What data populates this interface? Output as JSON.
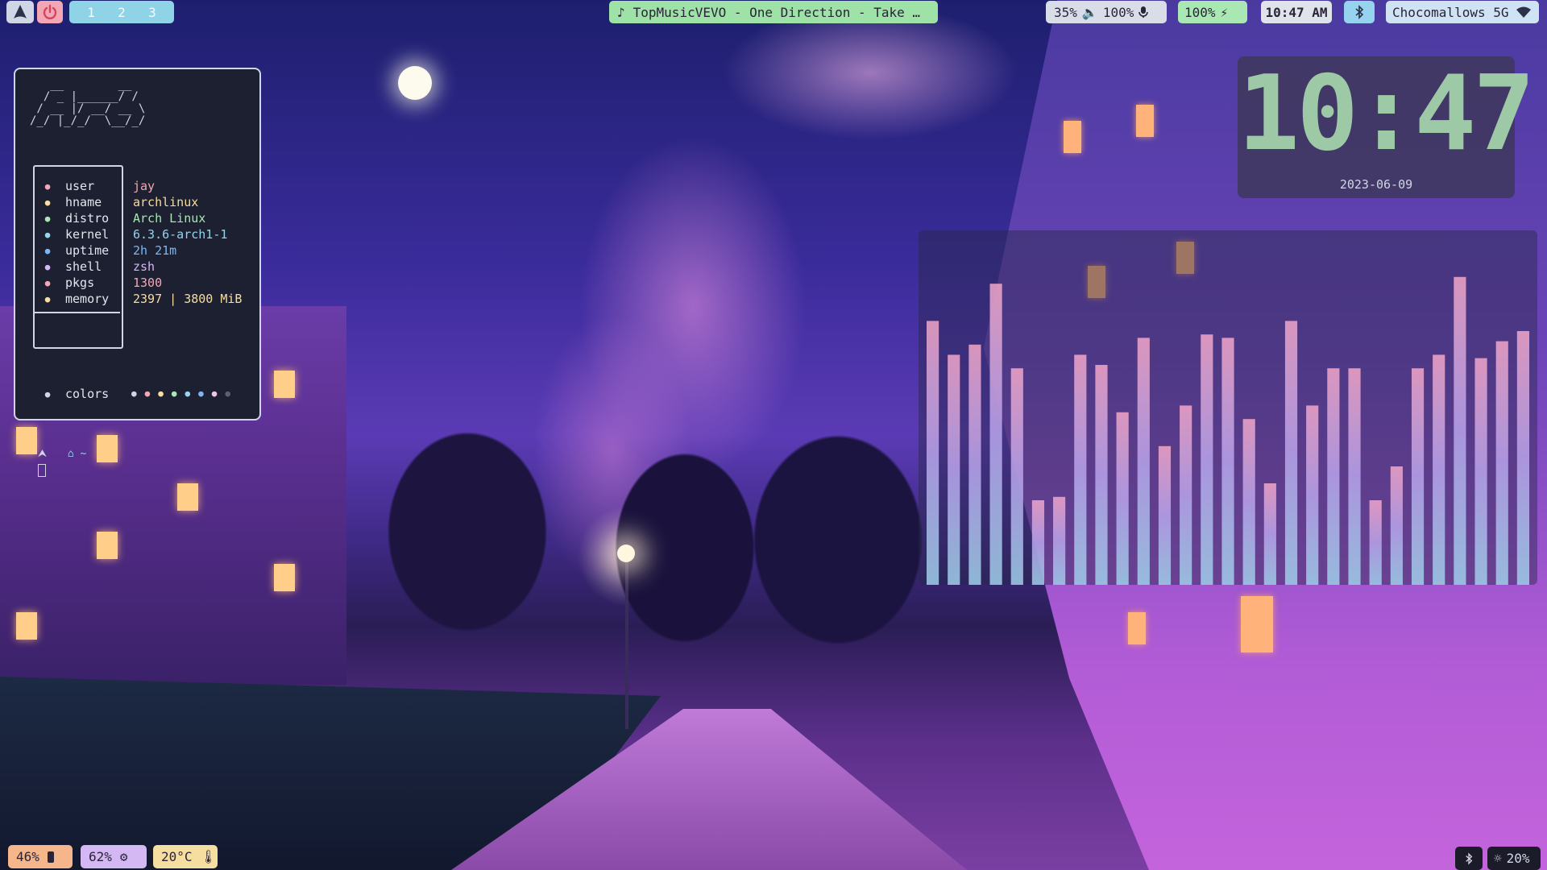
{
  "topbar": {
    "arch_icon": "arch-logo-icon",
    "power_icon": "power-icon",
    "workspaces": [
      "1",
      "2",
      "3"
    ],
    "music": {
      "icon": "music-note-icon",
      "text": "TopMusicVEVO - One Direction - Take …"
    },
    "volume": {
      "speaker_level": "35%",
      "mic_level": "100%"
    },
    "battery": {
      "level": "100%"
    },
    "time": "10:47 AM",
    "bluetooth_icon": "bluetooth-icon",
    "wifi": {
      "ssid": "Chocomallows 5G"
    }
  },
  "fetch": {
    "ascii_logo": "   __        __\n  / _ |______/ /\n / __ |/ __/ __ \\\n/_/ |_/_/  \\__/_/",
    "rows": [
      {
        "icon": "person-icon",
        "key": "user",
        "value": "jay",
        "color": "#f3a7b4"
      },
      {
        "icon": "hostname-icon",
        "key": "hname",
        "value": "archlinux",
        "color": "#f6dda0"
      },
      {
        "icon": "distro-icon",
        "key": "distro",
        "value": "Arch Linux",
        "color": "#a9e7b3"
      },
      {
        "icon": "kernel-icon",
        "key": "kernel",
        "value": "6.3.6-arch1-1",
        "color": "#95d3ee"
      },
      {
        "icon": "clock-icon",
        "key": "uptime",
        "value": "2h 21m",
        "color": "#7fb6f0"
      },
      {
        "icon": "terminal-icon",
        "key": "shell",
        "value": "zsh",
        "color": "#d4b8f4"
      },
      {
        "icon": "package-icon",
        "key": "pkgs",
        "value": "1300",
        "color": "#f3a7b4"
      },
      {
        "icon": "memory-icon",
        "key": "memory",
        "value": "2397 | 3800 MiB",
        "color": "#f6dda0"
      }
    ],
    "colors_label": "colors",
    "color_dots": [
      "#cfd6e6",
      "#f3a7b4",
      "#f6dda0",
      "#a9e7b3",
      "#95d3ee",
      "#7fb6f0",
      "#f3c4e4",
      "#5a5f73"
    ],
    "prompt": "~"
  },
  "clock": {
    "time": "10:47",
    "date": "2023-06-09"
  },
  "visualizer": {
    "bars": [
      0.78,
      0.68,
      0.71,
      0.89,
      0.64,
      0.25,
      0.26,
      0.68,
      0.65,
      0.51,
      0.73,
      0.41,
      0.53,
      0.74,
      0.73,
      0.49,
      0.3,
      0.78,
      0.53,
      0.64,
      0.64,
      0.25,
      0.35,
      0.64,
      0.68,
      0.91,
      0.67,
      0.72,
      0.75
    ]
  },
  "bottombar": {
    "battery": "46%",
    "cpu": "62%",
    "temp": "20°C",
    "brightness": "20%"
  }
}
